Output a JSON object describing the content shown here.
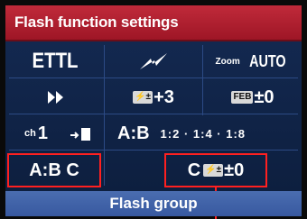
{
  "header": {
    "title": "Flash function settings"
  },
  "row1": {
    "mode": "ETTL",
    "zoom_label": "Zoom",
    "zoom_value": "AUTO"
  },
  "row2": {
    "fec_value": "+3",
    "feb_label": "FEB",
    "feb_value": "±0"
  },
  "row3": {
    "channel": "1",
    "ratio_label": "A:B",
    "ratio_values": "1:2 · 1:4 · 1:8"
  },
  "row4": {
    "group_value": "A:B C",
    "group_c_label": "C",
    "group_c_value": "±0"
  },
  "footer": {
    "label": "Flash group"
  },
  "colors": {
    "header_bg": "#b32030",
    "panel_bg": "#112449",
    "selection": "#ff2020",
    "footer_bg": "#4468a8"
  }
}
